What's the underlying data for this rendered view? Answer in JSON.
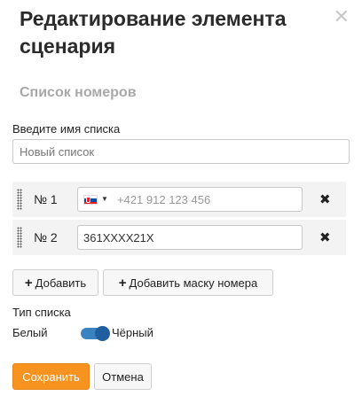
{
  "dialog": {
    "title": "Редактирование элемента сценария",
    "close_icon": "close-icon"
  },
  "section": {
    "title": "Список номеров"
  },
  "list_name": {
    "label": "Введите имя списка",
    "placeholder": "Новый список",
    "value": ""
  },
  "numbers": [
    {
      "label": "№ 1",
      "country_flag": "slovakia-flag-icon",
      "placeholder": "+421 912 123 456",
      "value": ""
    },
    {
      "label": "№ 2",
      "value": "361XXXX21X"
    }
  ],
  "buttons": {
    "add": "Добавить",
    "add_mask": "Добавить маску номера",
    "save": "Сохранить",
    "cancel": "Отмена"
  },
  "list_type": {
    "label": "Тип списка",
    "option_off": "Белый",
    "option_on": "Чёрный",
    "selected": "Чёрный"
  },
  "colors": {
    "primary": "#f7931e",
    "toggle": "#3b83c0",
    "section_title": "#a8a8a8"
  }
}
